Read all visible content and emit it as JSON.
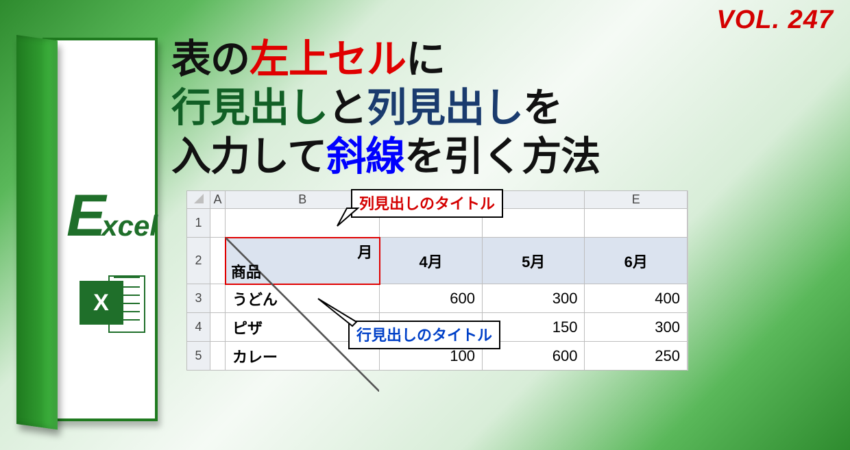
{
  "volume_label": "VOL. 247",
  "door": {
    "e_big": "E",
    "e_rest": "xcel",
    "icon_letter": "X"
  },
  "title": {
    "l1_a": "表の",
    "l1_b": "左上セル",
    "l1_c": "に",
    "l2_a": "行見出し",
    "l2_b": "と",
    "l2_c": "列見出し",
    "l2_d": "を",
    "l3_a": "入力して",
    "l3_b": "斜線",
    "l3_c": "を引く方法"
  },
  "sheet": {
    "col_letters": [
      "A",
      "B",
      "",
      "",
      "E"
    ],
    "row_nums": [
      "1",
      "2",
      "3",
      "4",
      "5"
    ],
    "diag_top": "月",
    "diag_bottom": "商品",
    "month_headers": [
      "4月",
      "5月",
      "6月"
    ],
    "rows": [
      {
        "item": "うどん",
        "vals": [
          "600",
          "300",
          "400"
        ]
      },
      {
        "item": "ピザ",
        "vals": [
          "",
          "150",
          "300"
        ]
      },
      {
        "item": "カレー",
        "vals": [
          "100",
          "600",
          "250"
        ]
      }
    ]
  },
  "callouts": {
    "col_title": "列見出しのタイトル",
    "row_title": "行見出しのタイトル"
  }
}
